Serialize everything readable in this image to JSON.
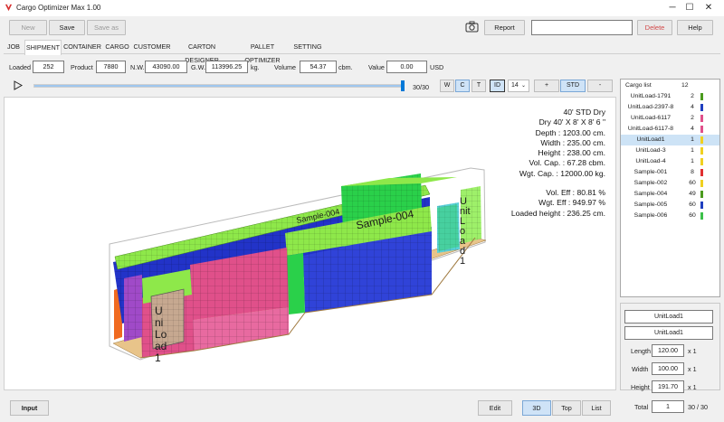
{
  "window": {
    "title": "Cargo Optimizer Max 1.00",
    "minimize": "─",
    "maximize": "☐",
    "close": "✕"
  },
  "toolbar": {
    "new_label": "New",
    "save_label": "Save",
    "save_as_label": "Save as",
    "report_label": "Report",
    "search_value": "",
    "delete_label": "Delete",
    "help_label": "Help"
  },
  "tabs": [
    "JOB",
    "SHIPMENT",
    "CONTAINER",
    "CARGO",
    "CUSTOMER",
    "CARTON DESIGNER",
    "PALLET OPTIMIZER",
    "SETTING"
  ],
  "selected_tab": "SHIPMENT",
  "summary": {
    "loaded_label": "Loaded",
    "loaded_value": "252",
    "product_label": "Product",
    "product_value": "7880",
    "nw_label": "N.W.",
    "nw_value": "43090.00",
    "gw_label": "G.W.",
    "gw_value": "113996.25",
    "weight_unit": "kg.",
    "volume_label": "Volume",
    "volume_value": "54.37",
    "volume_unit": "cbm.",
    "value_label": "Value",
    "value_value": "0.00",
    "currency": "USD"
  },
  "player": {
    "progress_text": "30/30",
    "progress": 1.0
  },
  "view_toggles": {
    "w": "W",
    "c": "C",
    "t": "T",
    "id": "ID",
    "font_size": "14",
    "plus": "+",
    "std": "STD",
    "minus": "-"
  },
  "cargo_list": {
    "header_label": "Cargo list",
    "header_count": "12",
    "items": [
      {
        "name": "UnitLoad-1791",
        "qty": "2",
        "color": "#4b9b1e"
      },
      {
        "name": "UnitLoad-2397-8",
        "qty": "4",
        "color": "#1f3fbf"
      },
      {
        "name": "UnitLoad-6117",
        "qty": "2",
        "color": "#e0508a"
      },
      {
        "name": "UnitLoad-6117-8",
        "qty": "4",
        "color": "#e0508a"
      },
      {
        "name": "UnitLoad1",
        "qty": "1",
        "color": "#f0d020"
      },
      {
        "name": "UnitLoad-3",
        "qty": "1",
        "color": "#f0d020"
      },
      {
        "name": "UnitLoad-4",
        "qty": "1",
        "color": "#f0d020"
      },
      {
        "name": "Sample-001",
        "qty": "8",
        "color": "#e03030"
      },
      {
        "name": "Sample-002",
        "qty": "60",
        "color": "#f0d020"
      },
      {
        "name": "Sample-004",
        "qty": "49",
        "color": "#4b9b1e"
      },
      {
        "name": "Sample-005",
        "qty": "60",
        "color": "#1f3fbf"
      },
      {
        "name": "Sample-006",
        "qty": "60",
        "color": "#3cc04a"
      }
    ],
    "selected": "UnitLoad1"
  },
  "details": {
    "name_field": "UnitLoad1",
    "name_field_2": "UnitLoad1",
    "length_label": "Length",
    "length_value": "120.00",
    "length_mult": "x 1",
    "width_label": "Width",
    "width_value": "100.00",
    "width_mult": "x 1",
    "height_label": "Height",
    "height_value": "191.70",
    "height_mult": "x 1",
    "total_label": "Total",
    "total_value": "1",
    "total_count": "30 / 30"
  },
  "stats": [
    "40' STD Dry",
    "Dry 40' X 8' X 8' 6 \"",
    "Depth : 1203.00 cm.",
    "Width : 235.00 cm.",
    "Height : 238.00 cm.",
    "Vol. Cap. : 67.28 cbm.",
    "Wgt. Cap. : 12000.00 kg.",
    "Vol. Eff : 80.81 %",
    "Wgt. Eff : 949.97 %",
    "Loaded height : 236.25 cm."
  ],
  "box_labels": [
    "Sample-004",
    "Sample-004",
    "Unit Load1",
    "Uni Load1"
  ],
  "bottom": {
    "input_label": "Input",
    "edit_label": "Edit",
    "view_3d": "3D",
    "view_top": "Top",
    "view_list": "List"
  },
  "colors": {
    "accent": "#0078d7",
    "delete_text": "#d24a4a",
    "blue_cargo": "#2233c8",
    "pink_cargo": "#e0508a",
    "lime_cargo": "#8ee84a",
    "green_cargo": "#2ad04a",
    "wood": "#e8c48a"
  }
}
